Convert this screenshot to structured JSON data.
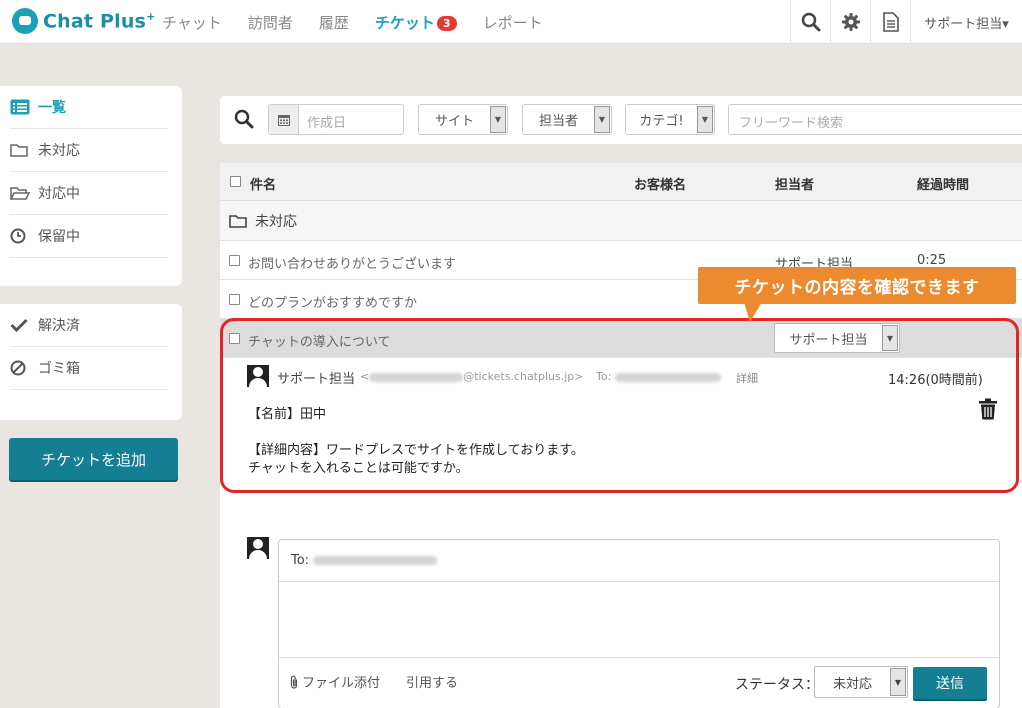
{
  "app": {
    "logo_text": "Chat Plus",
    "logo_sup": "+"
  },
  "nav": {
    "items": [
      {
        "label": "チャット"
      },
      {
        "label": "訪問者"
      },
      {
        "label": "履歴"
      },
      {
        "label": "チケット",
        "badge": "3",
        "active": true
      },
      {
        "label": "レポート"
      }
    ],
    "user_menu": "サポート担当▾",
    "icons": [
      "search-icon",
      "gear-icon",
      "document-icon"
    ]
  },
  "sidebar": {
    "items": [
      {
        "label": "一覧",
        "icon": "list-icon",
        "active": true
      },
      {
        "label": "未対応",
        "icon": "folder-icon"
      },
      {
        "label": "対応中",
        "icon": "folder-open-icon"
      },
      {
        "label": "保留中",
        "icon": "clock-icon"
      }
    ],
    "items2": [
      {
        "label": "解決済",
        "icon": "check-icon"
      },
      {
        "label": "ゴミ箱",
        "icon": "ban-icon"
      }
    ],
    "add_button": "チケットを追加"
  },
  "filter": {
    "date_placeholder": "作成日",
    "site": "サイト",
    "assignee": "担当者",
    "category": "カテゴ!",
    "freeword_placeholder": "フリーワード検索"
  },
  "table": {
    "headers": {
      "subject": "件名",
      "customer": "お客様名",
      "assignee": "担当者",
      "elapsed": "経過時間"
    },
    "group": "未対応",
    "rows": [
      {
        "subject": "お問い合わせありがとうございます",
        "assignee": "サポート担当",
        "elapsed": "0:25"
      },
      {
        "subject": "どのプランがおすすめですか",
        "assignee": "",
        "elapsed": ""
      },
      {
        "subject": "チャットの導入について",
        "assignee_select": "サポート担当"
      }
    ]
  },
  "message": {
    "sender": "サポート担当",
    "email_prefix": "<",
    "email_domain": "@tickets.chatplus.jp>",
    "to_label": "To:",
    "detail": "詳細",
    "time": "14:26(0時間前)",
    "lines": [
      "【名前】田中",
      "【詳細内容】ワードプレスでサイトを作成しております。",
      "チャットを入れることは可能ですか。"
    ]
  },
  "reply": {
    "to_label": "To:",
    "attach": "ファイル添付",
    "quote": "引用する",
    "status_label": "ステータス：",
    "status_value": "未対応",
    "send": "送信"
  },
  "annotation": {
    "text": "チケットの内容を確認できます"
  },
  "colors": {
    "accent": "#1aa1b8",
    "button": "#147e92",
    "badge": "#e53935",
    "callout": "#ec8a2f",
    "highlight": "#e0262a"
  }
}
